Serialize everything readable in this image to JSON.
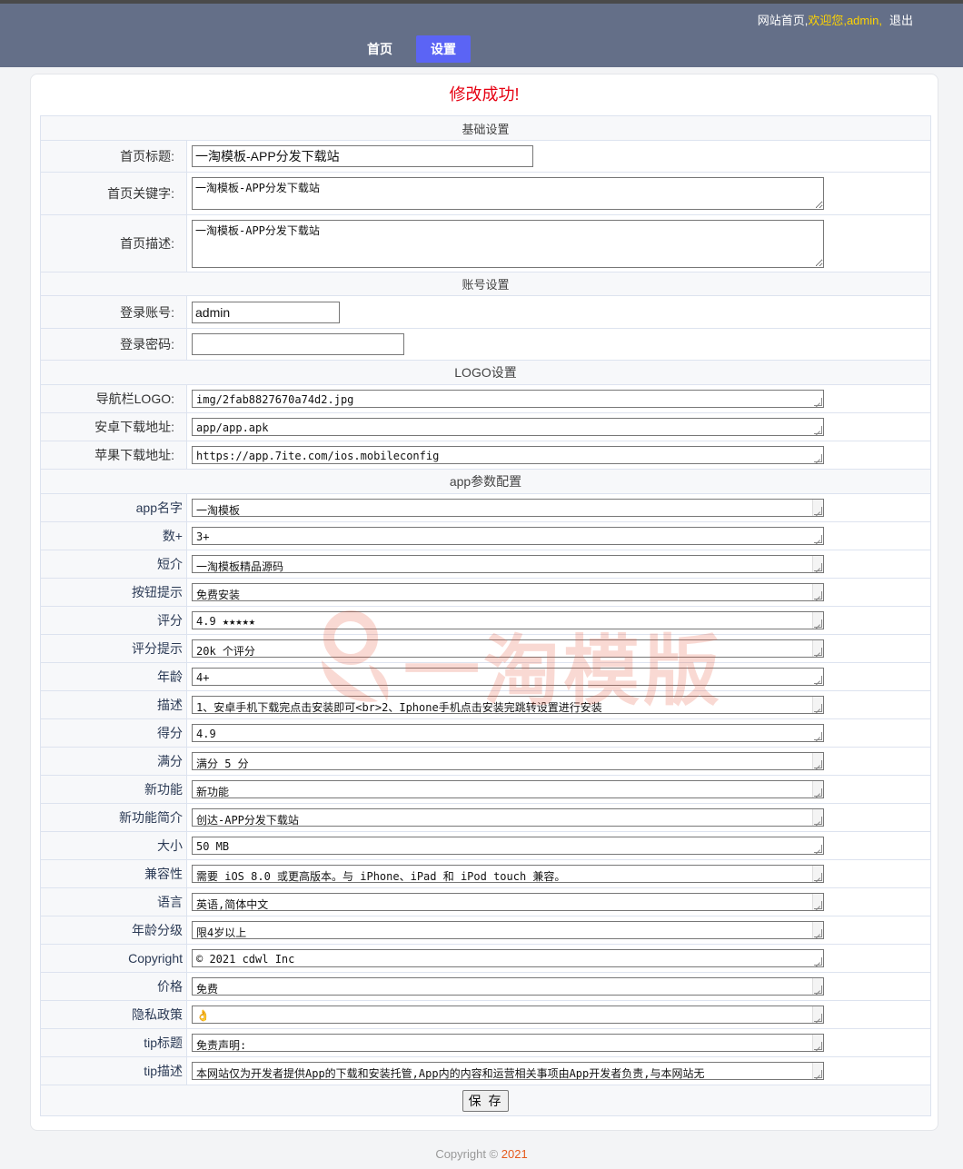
{
  "header": {
    "site_home": "网站首页,",
    "welcome": "欢迎您,",
    "username": "admin,",
    "logout": "退出"
  },
  "nav": {
    "home": "首页",
    "settings": "设置"
  },
  "message": "修改成功!",
  "sections": {
    "basic": "基础设置",
    "account": "账号设置",
    "logo": "LOGO设置",
    "app": "app参数配置"
  },
  "basic": {
    "title_label": "首页标题:",
    "title_value": "一淘模板-APP分发下载站",
    "keywords_label": "首页关键字:",
    "keywords_value": "一淘模板-APP分发下载站",
    "desc_label": "首页描述:",
    "desc_value": "一淘模板-APP分发下载站"
  },
  "account": {
    "user_label": "登录账号:",
    "user_value": "admin",
    "pass_label": "登录密码:",
    "pass_value": ""
  },
  "logo": {
    "nav_logo_label": "导航栏LOGO:",
    "nav_logo_value": "img/2fab8827670a74d2.jpg",
    "android_label": "安卓下载地址:",
    "android_value": "app/app.apk",
    "apple_label": "苹果下载地址:",
    "apple_value": "https://app.7ite.com/ios.mobileconfig"
  },
  "app_params": [
    {
      "label": "app名字",
      "value": "一淘模板"
    },
    {
      "label": "数+",
      "value": "3+"
    },
    {
      "label": "短介",
      "value": "一淘模板精品源码"
    },
    {
      "label": "按钮提示",
      "value": "免费安装"
    },
    {
      "label": "评分",
      "value": "4.9 ★★★★★"
    },
    {
      "label": "评分提示",
      "value": "20k 个评分"
    },
    {
      "label": "年龄",
      "value": "4+"
    },
    {
      "label": "描述",
      "value": "1、安卓手机下载完点击安装即可<br>2、Iphone手机点击安装完跳转设置进行安装"
    },
    {
      "label": "得分",
      "value": "4.9"
    },
    {
      "label": "满分",
      "value": "满分 5 分"
    },
    {
      "label": "新功能",
      "value": "新功能"
    },
    {
      "label": "新功能简介",
      "value": "创达-APP分发下载站"
    },
    {
      "label": "大小",
      "value": "50 MB"
    },
    {
      "label": "兼容性",
      "value": "需要 iOS 8.0 或更高版本。与 iPhone、iPad 和 iPod touch 兼容。"
    },
    {
      "label": "语言",
      "value": "英语,简体中文"
    },
    {
      "label": "年龄分级",
      "value": "限4岁以上"
    },
    {
      "label": "Copyright",
      "value": "© 2021 cdwl Inc"
    },
    {
      "label": "价格",
      "value": "免费"
    },
    {
      "label": "隐私政策",
      "value": "👌"
    },
    {
      "label": "tip标题",
      "value": "免责声明:"
    },
    {
      "label": "tip描述",
      "value": "本网站仅为开发者提供App的下载和安装托管,App内的内容和运营相关事项由App开发者负责,与本网站无"
    }
  ],
  "app_params_scrollbar": [
    true,
    false,
    true,
    true,
    true,
    true,
    false,
    true,
    false,
    true,
    true,
    true,
    false,
    true,
    true,
    true,
    false,
    true,
    true,
    true,
    true
  ],
  "save_button": "保 存",
  "watermark": "一淘模版",
  "footer": {
    "prefix": "Copyright © ",
    "year": "2021"
  }
}
